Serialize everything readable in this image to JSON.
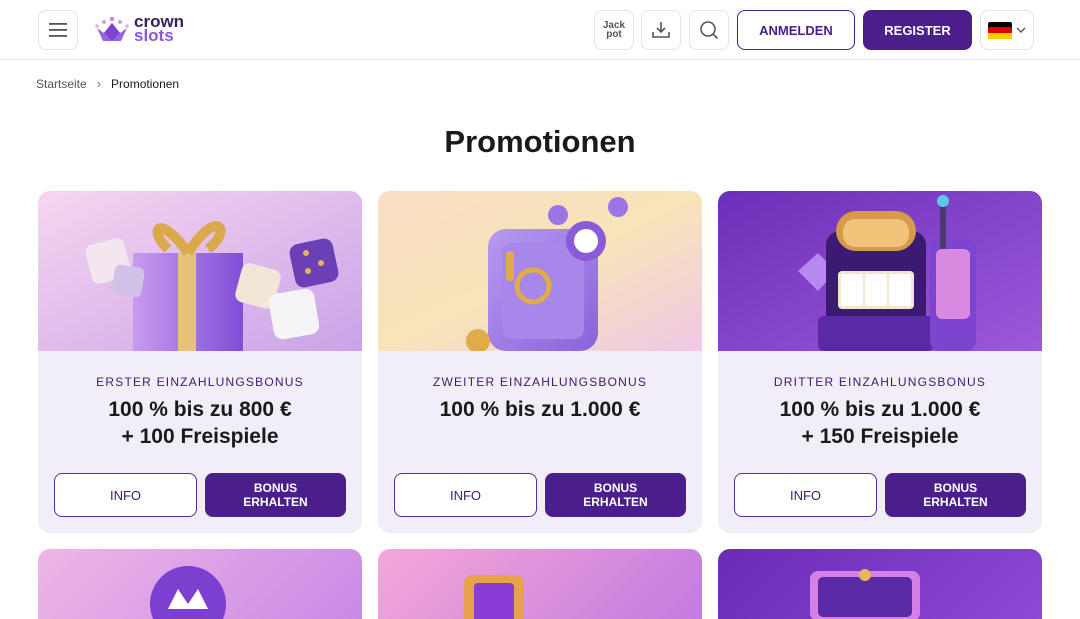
{
  "header": {
    "logo_line1": "crown",
    "logo_line2": "slots",
    "jackpot_line1": "Jack",
    "jackpot_line2": "pot",
    "login_label": "ANMELDEN",
    "register_label": "REGISTER",
    "language": "DE"
  },
  "breadcrumb": {
    "home": "Startseite",
    "separator": "›",
    "current": "Promotionen"
  },
  "page_title": "Promotionen",
  "cards": [
    {
      "kicker": "ERSTER EINZAHLUNGSBONUS",
      "title_line1": "100 % bis zu 800 €",
      "title_line2": "+ 100 Freispiele",
      "info_label": "INFO",
      "bonus_label": "BONUS ERHALTEN"
    },
    {
      "kicker": "ZWEITER EINZAHLUNGSBONUS",
      "title_line1": "100 % bis zu 1.000 €",
      "title_line2": "",
      "info_label": "INFO",
      "bonus_label": "BONUS ERHALTEN"
    },
    {
      "kicker": "DRITTER EINZAHLUNGSBONUS",
      "title_line1": "100 % bis zu 1.000 €",
      "title_line2": "+ 150 Freispiele",
      "info_label": "INFO",
      "bonus_label": "BONUS ERHALTEN"
    }
  ],
  "colors": {
    "brand": "#4a1f8c",
    "card_bg": "#f1eef8",
    "accent": "#8b57d8"
  },
  "icons": [
    "menu-icon",
    "crown-icon",
    "jackpot-icon",
    "download-icon",
    "search-icon",
    "german-flag-icon",
    "chevron-down-icon"
  ]
}
